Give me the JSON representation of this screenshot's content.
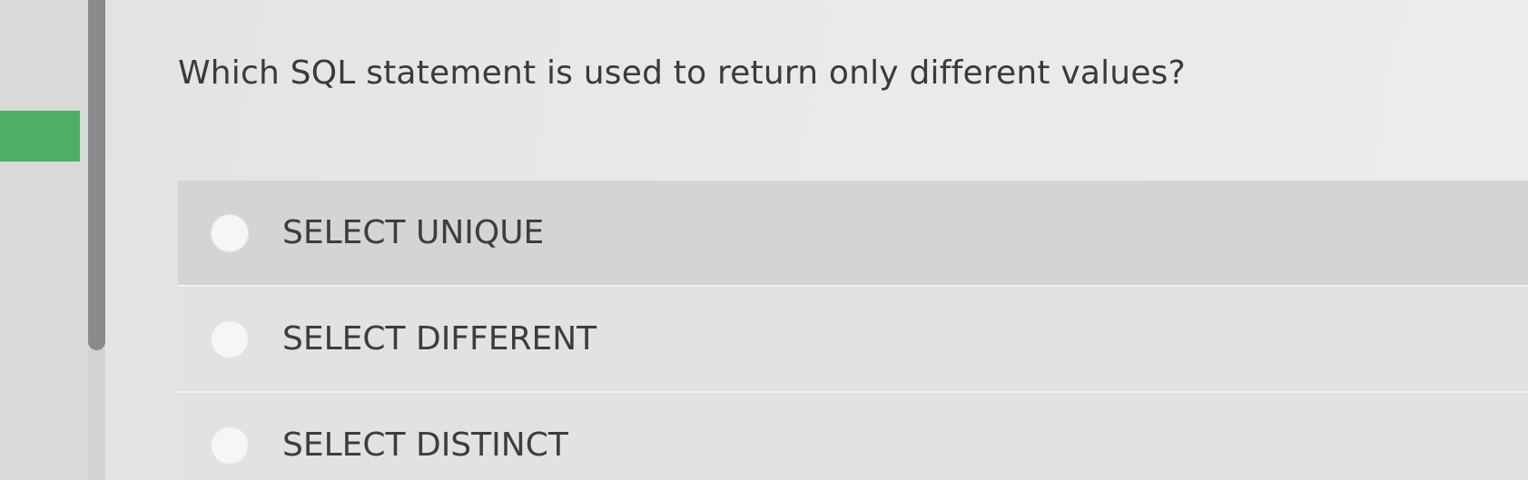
{
  "question": {
    "text": "Which SQL statement is used to return only different values?"
  },
  "options": [
    {
      "label": "SELECT UNIQUE",
      "highlighted": true
    },
    {
      "label": "SELECT DIFFERENT",
      "highlighted": false
    },
    {
      "label": "SELECT DISTINCT",
      "highlighted": false
    }
  ],
  "colors": {
    "accent_tab": "#4caf63",
    "scrollbar": "#8a8a8c"
  }
}
